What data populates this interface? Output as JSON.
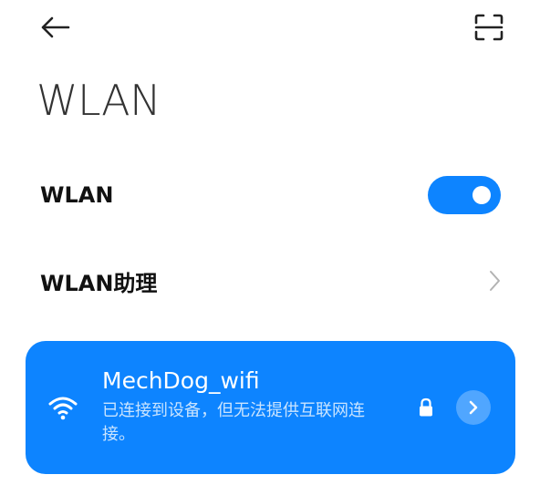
{
  "header": {
    "back_icon": "arrow-left-icon",
    "scan_icon": "scan-qr-icon",
    "title": "WLAN"
  },
  "settings": {
    "wlan_label": "WLAN",
    "wlan_enabled": true,
    "assistant_label": "WLAN助理"
  },
  "connected_network": {
    "ssid": "MechDog_wifi",
    "status": "已连接到设备，但无法提供互联网连接。",
    "secured": true,
    "wifi_icon": "wifi-icon",
    "lock_icon": "lock-icon",
    "detail_icon": "chevron-right-icon"
  },
  "colors": {
    "accent": "#0d84ff",
    "title_text": "#333333",
    "label_text": "#111111",
    "chevron": "#b3b3b3"
  }
}
